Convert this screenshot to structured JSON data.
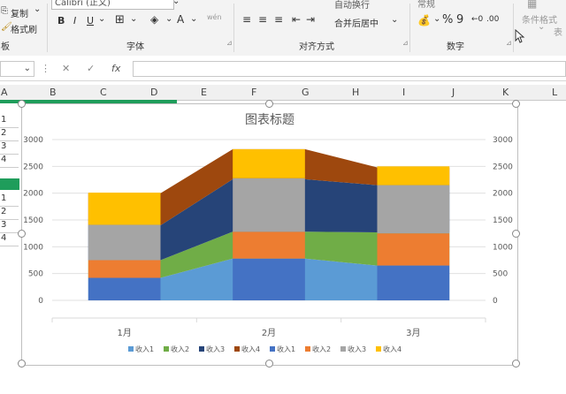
{
  "ribbon": {
    "copy_label": "复制",
    "format_painter_label": "格式刷",
    "clipboard_label": "板",
    "font_name": "Calibri (正文)",
    "bold": "B",
    "italic": "I",
    "underline": "U",
    "font_group_label": "字体",
    "wrap_label": "自动换行",
    "merge_label": "合并后居中",
    "align_group_label": "对齐方式",
    "number_format": "常规",
    "percent": "%",
    "comma": "9",
    "number_group_label": "数字",
    "cond_format_label": "条件格式",
    "table_label": "表"
  },
  "formula_bar": {
    "fx": "fx",
    "cancel": "✕",
    "confirm": "✓"
  },
  "columns": [
    "A",
    "B",
    "C",
    "D",
    "E",
    "F",
    "G",
    "H",
    "I",
    "J",
    "K",
    "L"
  ],
  "rows_top": [
    "1",
    "2",
    "3",
    "4"
  ],
  "rows_bottom": [
    "1",
    "2",
    "3",
    "4"
  ],
  "colors": {
    "excel_green": "#1f9d5b"
  },
  "chart_data": {
    "type": "area",
    "stacked": true,
    "title": "图表标题",
    "categories": [
      "1月",
      "2月",
      "3月"
    ],
    "ylim": [
      0,
      3000
    ],
    "yticks": [
      0,
      500,
      1000,
      1500,
      2000,
      2500,
      3000
    ],
    "secondary_yticks": [
      0,
      500,
      1000,
      1500,
      2000,
      2500,
      3000
    ],
    "grid": true,
    "legend_position": "bottom",
    "area_series": [
      {
        "name": "收入1",
        "color": "#5b9bd5",
        "values": [
          420,
          780,
          650
        ]
      },
      {
        "name": "收入2",
        "color": "#70ad47",
        "values": [
          330,
          500,
          620
        ]
      },
      {
        "name": "收入3",
        "color": "#264478",
        "values": [
          650,
          980,
          880
        ]
      },
      {
        "name": "收入4",
        "color": "#9e480e",
        "values": [
          600,
          560,
          330
        ]
      }
    ],
    "bar_series": [
      {
        "name": "收入1",
        "color": "#4472c4",
        "values": [
          420,
          780,
          650
        ]
      },
      {
        "name": "收入2",
        "color": "#ed7d31",
        "values": [
          330,
          500,
          600
        ]
      },
      {
        "name": "收入3",
        "color": "#a5a5a5",
        "values": [
          660,
          1000,
          900
        ]
      },
      {
        "name": "收入4",
        "color": "#ffc000",
        "values": [
          600,
          540,
          350
        ]
      }
    ],
    "legend": [
      "收入1",
      "收入2",
      "收入3",
      "收入4",
      "收入1",
      "收入2",
      "收入3",
      "收入4"
    ],
    "legend_colors": [
      "#5b9bd5",
      "#70ad47",
      "#264478",
      "#9e480e",
      "#4472c4",
      "#ed7d31",
      "#a5a5a5",
      "#ffc000"
    ]
  }
}
